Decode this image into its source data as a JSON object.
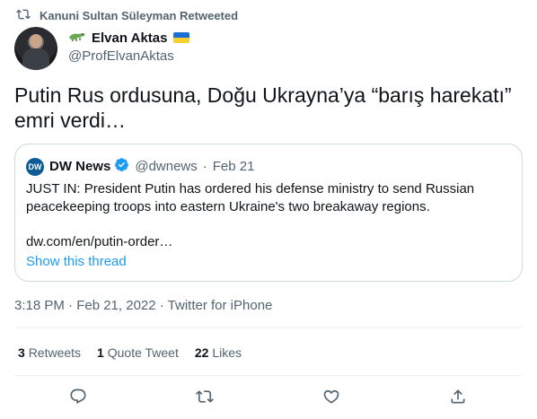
{
  "retweet": {
    "text": "Kanuni Sultan Süleyman Retweeted"
  },
  "author": {
    "display_name": "Elvan Aktas",
    "handle": "@ProfElvanAktas"
  },
  "tweet": {
    "text": "Putin Rus ordusuna, Doğu Ukrayna’ya “barış harekatı” emri verdi…"
  },
  "quote": {
    "logo_text": "DW",
    "name": "DW News",
    "handle": "@dwnews",
    "separator": "·",
    "date": "Feb 21",
    "body": "JUST IN: President Putin has ordered his defense ministry to send Russian peacekeeping troops into eastern Ukraine's two breakaway regions.",
    "link": "dw.com/en/putin-order…",
    "show_thread": "Show this thread"
  },
  "meta": {
    "timestamp": "3:18 PM · Feb 21, 2022 · Twitter for iPhone"
  },
  "stats": {
    "retweets_count": "3",
    "retweets_label": "Retweets",
    "quotes_count": "1",
    "quotes_label": "Quote Tweet",
    "likes_count": "22",
    "likes_label": "Likes"
  },
  "actions": [
    {
      "icon": "reply-icon"
    },
    {
      "icon": "retweet-icon"
    },
    {
      "icon": "like-icon"
    },
    {
      "icon": "share-icon"
    }
  ],
  "colors": {
    "accent": "#1d9bf0",
    "secondary_text": "#536471",
    "border": "#cfd9de"
  }
}
